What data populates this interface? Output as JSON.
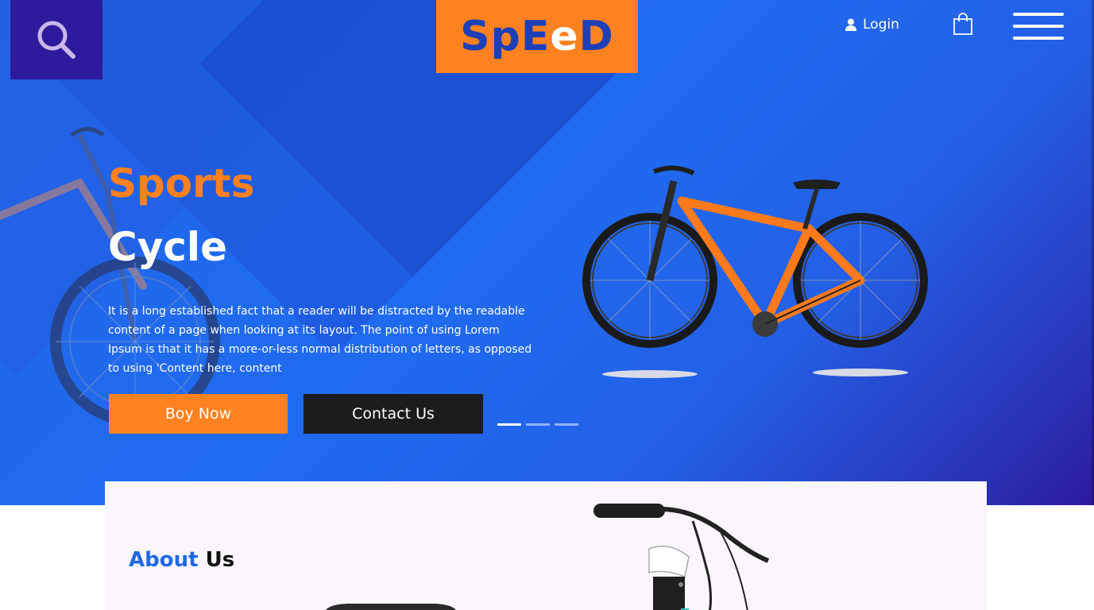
{
  "header": {
    "logo": {
      "part1": "SpE",
      "part2": "e",
      "part3": "D"
    },
    "login_label": "Login",
    "icons": {
      "search": "search-icon",
      "user": "user-icon",
      "cart": "shopping-bag-icon",
      "menu": "hamburger-menu-icon"
    }
  },
  "hero": {
    "title_line1": "Sports",
    "title_line2": "Cycle",
    "description": "It is a long established fact that a reader will be distracted by the readable content of a page when looking at its layout. The point of using Lorem Ipsum is that it has a more-or-less normal distribution of letters, as opposed to using 'Content here, content",
    "buttons": {
      "primary": "Boy Now",
      "secondary": "Contact Us"
    },
    "slider": {
      "count": 3,
      "active_index": 0
    }
  },
  "about": {
    "title_accent": "About",
    "title_rest": "Us"
  },
  "colors": {
    "brand_orange": "#ff8120",
    "brand_blue": "#1f67e6",
    "search_box": "#2e1a9c",
    "dark_button": "#1c1c1c"
  }
}
